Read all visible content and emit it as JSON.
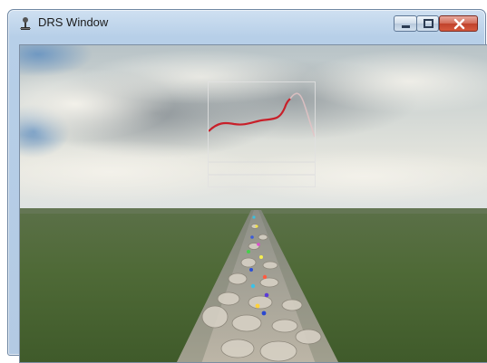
{
  "window": {
    "title": "DRS Window",
    "icon": "joystick-icon",
    "controls": [
      "minimize-icon",
      "maximize-icon",
      "close-icon"
    ]
  },
  "scene": {
    "description_type": "3d-simulation",
    "sky_color": "#c9d4dc",
    "ground_color": "#4a6b34",
    "road_color": "#b9b3a6",
    "plot_line_color": "#c8202a"
  }
}
